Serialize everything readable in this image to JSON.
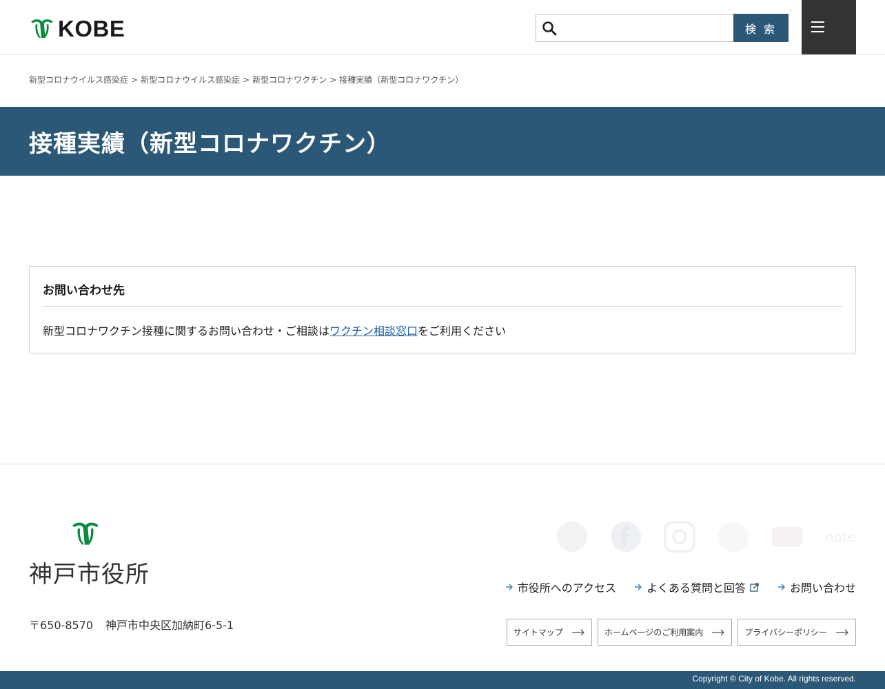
{
  "header": {
    "logo_text": "KOBE",
    "search": {
      "placeholder": "",
      "value": "",
      "button_label": "検 索"
    },
    "brand_color": "#2c5877"
  },
  "breadcrumb": [
    "新型コロナウイルス感染症",
    "新型コロナウイルス感染症",
    "新型コロナワクチン",
    "接種実績（新型コロナワクチン）"
  ],
  "breadcrumb_separator": ">",
  "page": {
    "title": "接種実績（新型コロナワクチン）"
  },
  "contact": {
    "heading": "お問い合わせ先",
    "text_before": "新型コロナワクチン接種に関するお問い合わせ・ご相談は",
    "link_text": "ワクチン相談窓口",
    "text_after": "をご利用ください"
  },
  "footer": {
    "org_name": "神戸市役所",
    "postal": "〒650-8570",
    "address": "神戸市中央区加納町6-5-1",
    "sns_icons": [
      "line-icon",
      "facebook-icon",
      "instagram-icon",
      "twitter-icon",
      "youtube-icon",
      "note-icon"
    ],
    "links": [
      {
        "label": "市役所へのアクセス",
        "external": false
      },
      {
        "label": "よくある質問と回答",
        "external": true
      },
      {
        "label": "お問い合わせ",
        "external": false
      }
    ],
    "buttons": [
      "サイトマップ",
      "ホームページのご利用案内",
      "プライバシーポリシー"
    ],
    "copyright": "Copyright © City of Kobe. All rights reserved."
  }
}
